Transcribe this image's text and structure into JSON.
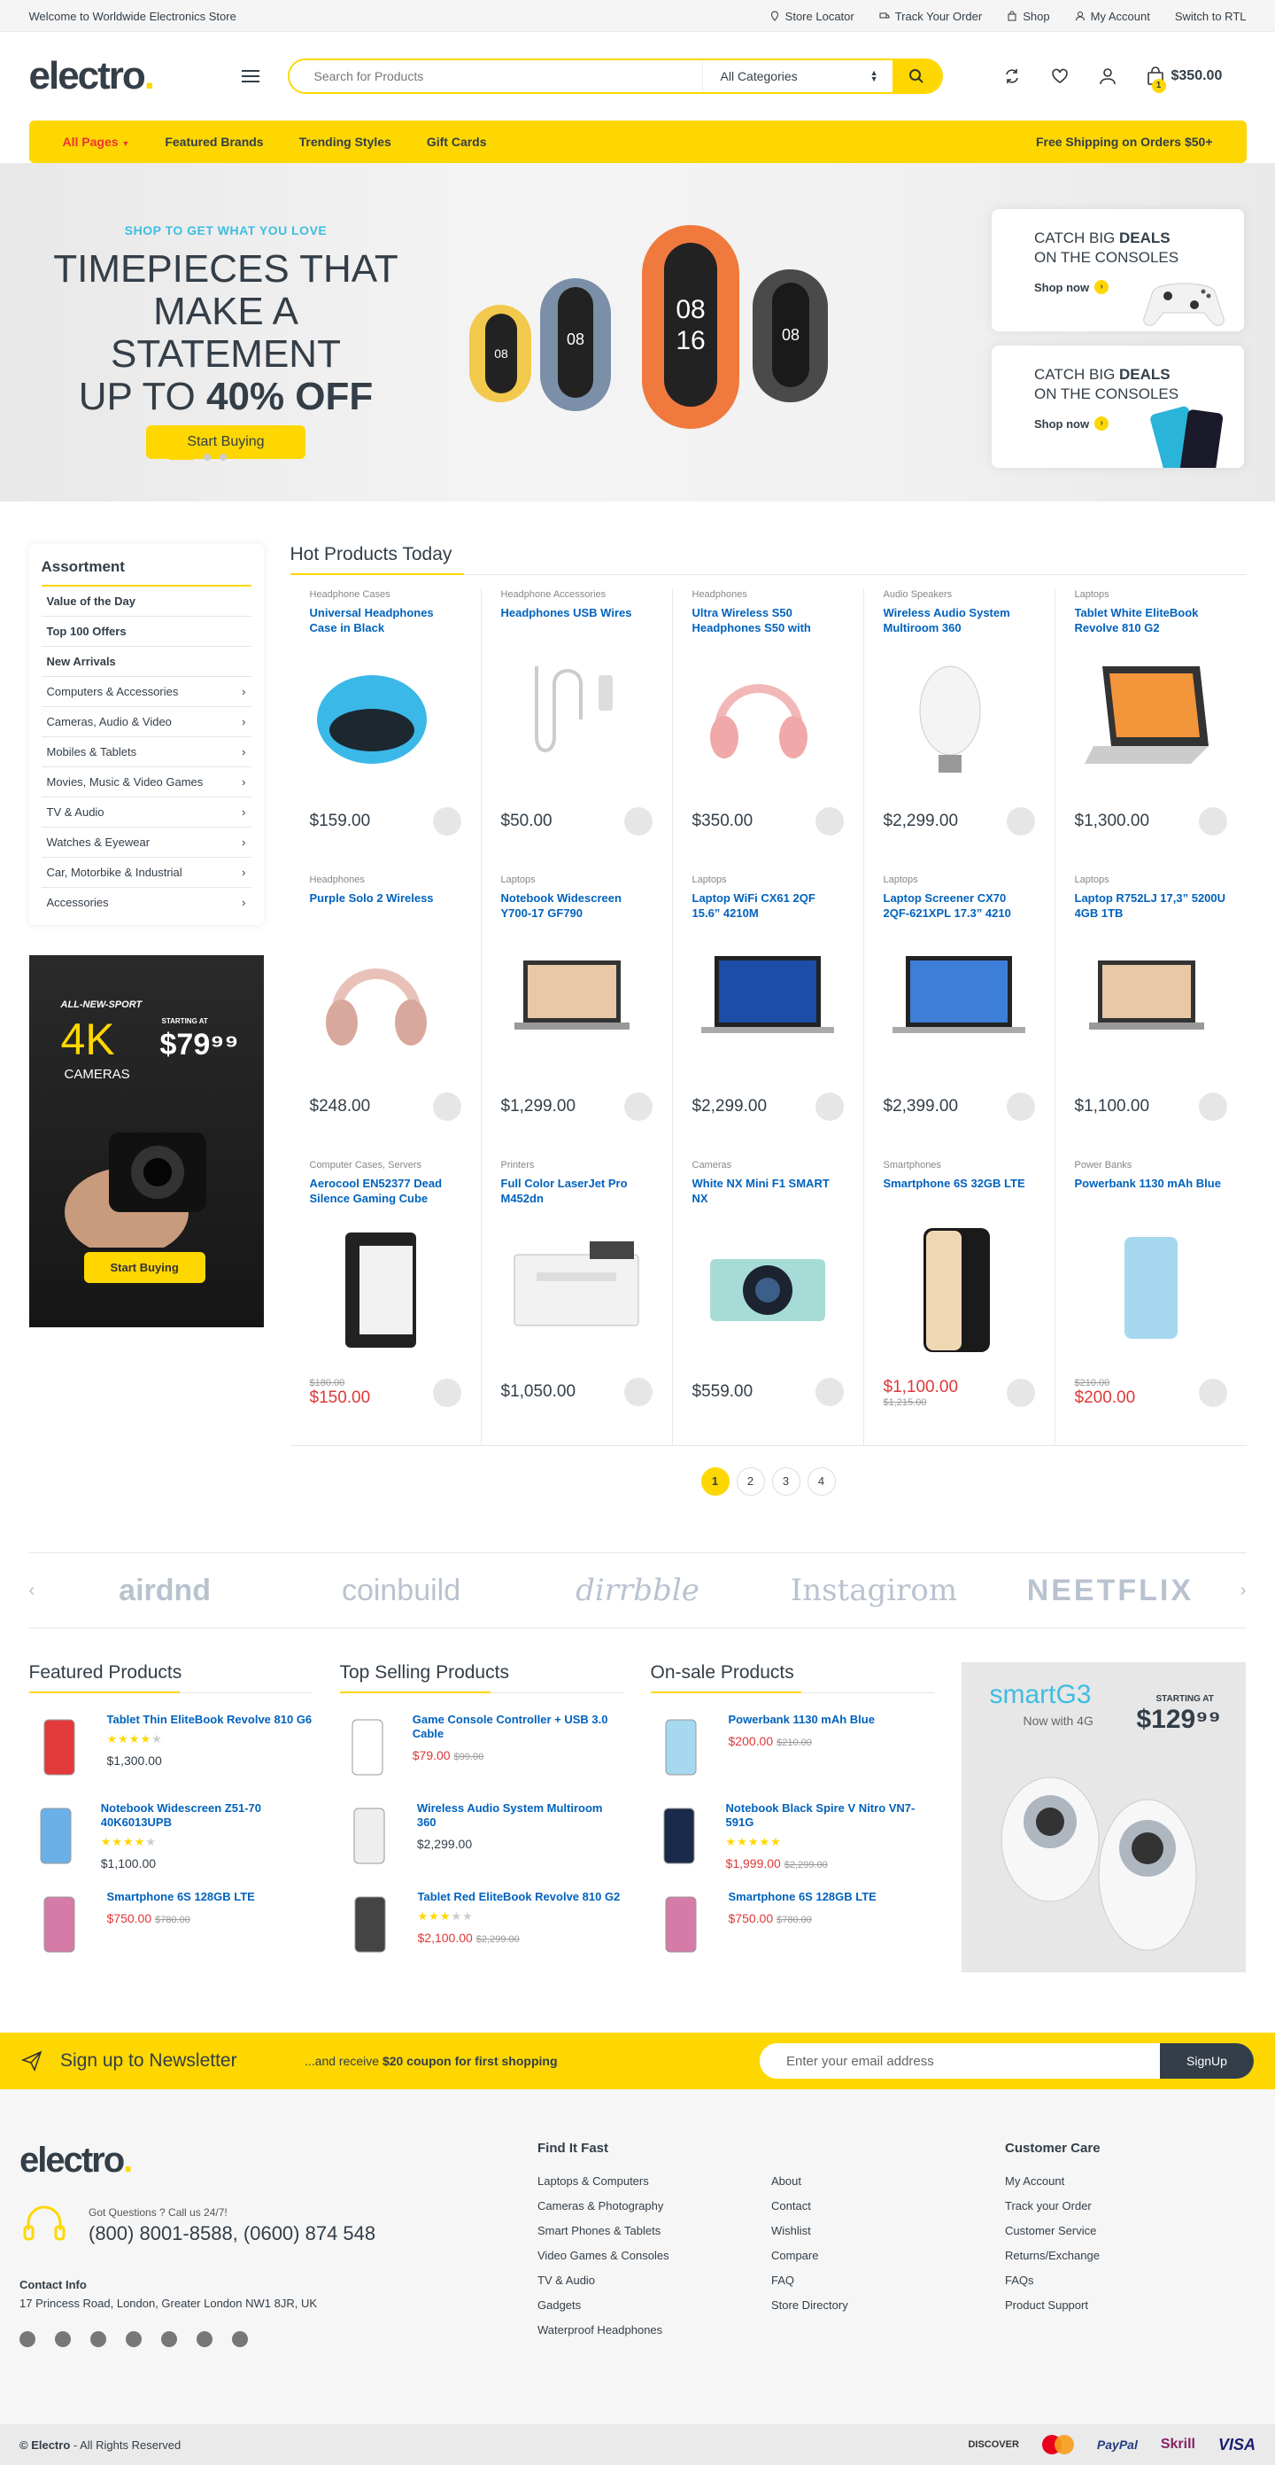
{
  "topbar": {
    "welcome": "Welcome to Worldwide Electronics Store",
    "links": [
      "Store Locator",
      "Track Your Order",
      "Shop",
      "My Account",
      "Switch to RTL"
    ]
  },
  "header": {
    "logo": "electro",
    "search_placeholder": "Search for Products",
    "category": "All Categories",
    "cart_total": "$350.00",
    "cart_count": "1"
  },
  "nav": {
    "items": [
      "All Pages",
      "Featured Brands",
      "Trending Styles",
      "Gift Cards"
    ],
    "shipping": "Free Shipping on Orders $50+"
  },
  "hero": {
    "subtitle": "SHOP TO GET WHAT YOU LOVE",
    "title_line1": "TIMEPIECES THAT",
    "title_line2": "MAKE A STATEMENT",
    "title_line3_a": "UP TO ",
    "title_line3_b": "40% OFF",
    "button": "Start Buying",
    "promo1": {
      "title_a": "CATCH BIG ",
      "title_b": "DEALS",
      "title_c": " ON THE CONSOLES",
      "cta": "Shop now"
    },
    "promo2": {
      "title_a": "CATCH BIG ",
      "title_b": "DEALS",
      "title_c": " ON THE CONSOLES",
      "cta": "Shop now"
    }
  },
  "sidebar": {
    "title": "Assortment",
    "bold_items": [
      "Value of the Day",
      "Top 100 Offers",
      "New Arrivals"
    ],
    "items": [
      "Computers & Accessories",
      "Cameras, Audio & Video",
      "Mobiles & Tablets",
      "Movies, Music & Video Games",
      "TV & Audio",
      "Watches & Eyewear",
      "Car, Motorbike & Industrial",
      "Accessories"
    ],
    "ad": {
      "line1": "ALL-NEW-SPORT",
      "big": "4K",
      "line2": "CAMERAS",
      "starting": "STARTING AT",
      "price": "$79⁹⁹",
      "button": "Start Buying"
    }
  },
  "hot": {
    "title": "Hot Products Today",
    "products": [
      {
        "cat": "Headphone Cases",
        "name": "Universal Headphones Case in Black",
        "price": "$159.00",
        "old": "",
        "sale": false
      },
      {
        "cat": "Headphone Accessories",
        "name": "Headphones USB Wires",
        "price": "$50.00",
        "old": "",
        "sale": false
      },
      {
        "cat": "Headphones",
        "name": "Ultra Wireless S50 Headphones S50 with",
        "price": "$350.00",
        "old": "",
        "sale": false
      },
      {
        "cat": "Audio Speakers",
        "name": "Wireless Audio System Multiroom 360",
        "price": "$2,299.00",
        "old": "",
        "sale": false
      },
      {
        "cat": "Laptops",
        "name": "Tablet White EliteBook Revolve 810 G2",
        "price": "$1,300.00",
        "old": "",
        "sale": false
      },
      {
        "cat": "Headphones",
        "name": "Purple Solo 2 Wireless",
        "price": "$248.00",
        "old": "",
        "sale": false
      },
      {
        "cat": "Laptops",
        "name": "Notebook Widescreen Y700-17 GF790",
        "price": "$1,299.00",
        "old": "",
        "sale": false
      },
      {
        "cat": "Laptops",
        "name": "Laptop WiFi CX61 2QF 15.6” 4210M",
        "price": "$2,299.00",
        "old": "",
        "sale": false
      },
      {
        "cat": "Laptops",
        "name": "Laptop Screener CX70 2QF-621XPL 17.3” 4210",
        "price": "$2,399.00",
        "old": "",
        "sale": false
      },
      {
        "cat": "Laptops",
        "name": "Laptop R752LJ 17,3” 5200U 4GB 1TB",
        "price": "$1,100.00",
        "old": "",
        "sale": false
      },
      {
        "cat": "Computer Cases, Servers",
        "name": "Aerocool EN52377 Dead Silence Gaming Cube",
        "price": "$150.00",
        "old": "$180.00",
        "sale": true
      },
      {
        "cat": "Printers",
        "name": "Full Color LaserJet Pro M452dn",
        "price": "$1,050.00",
        "old": "",
        "sale": false
      },
      {
        "cat": "Cameras",
        "name": "White NX Mini F1 SMART NX",
        "price": "$559.00",
        "old": "",
        "sale": false
      },
      {
        "cat": "Smartphones",
        "name": "Smartphone 6S 32GB LTE",
        "price": "$1,100.00",
        "old": "$1,215.00",
        "sale": true
      },
      {
        "cat": "Power Banks",
        "name": "Powerbank 1130 mAh Blue",
        "price": "$200.00",
        "old": "$210.00",
        "sale": true
      }
    ],
    "pages": [
      "1",
      "2",
      "3",
      "4"
    ]
  },
  "brands": [
    "airdnd",
    "coinbuild",
    "dirrbble",
    "Instagirom",
    "NEETFLIX"
  ],
  "lists": [
    {
      "title": "Featured Products",
      "items": [
        {
          "name": "Tablet Thin EliteBook Revolve 810 G6",
          "stars": 4,
          "price": "$1,300.00",
          "old": "",
          "sale": false
        },
        {
          "name": "Notebook Widescreen Z51-70 40K6013UPB",
          "stars": 4,
          "price": "$1,100.00",
          "old": "",
          "sale": false
        },
        {
          "name": "Smartphone 6S 128GB LTE",
          "stars": 0,
          "price": "$750.00",
          "old": "$780.00",
          "sale": true
        }
      ]
    },
    {
      "title": "Top Selling Products",
      "items": [
        {
          "name": "Game Console Controller + USB 3.0 Cable",
          "stars": 0,
          "price": "$79.00",
          "old": "$99.00",
          "sale": true
        },
        {
          "name": "Wireless Audio System Multiroom 360",
          "stars": 0,
          "price": "$2,299.00",
          "old": "",
          "sale": false
        },
        {
          "name": "Tablet Red EliteBook Revolve 810 G2",
          "stars": 3,
          "price": "$2,100.00",
          "old": "$2,299.00",
          "sale": true
        }
      ]
    },
    {
      "title": "On-sale Products",
      "items": [
        {
          "name": "Powerbank 1130 mAh Blue",
          "stars": 0,
          "price": "$200.00",
          "old": "$210.00",
          "sale": true
        },
        {
          "name": "Notebook Black Spire V Nitro VN7-591G",
          "stars": 5,
          "price": "$1,999.00",
          "old": "$2,299.00",
          "sale": true
        },
        {
          "name": "Smartphone 6S 128GB LTE",
          "stars": 0,
          "price": "$750.00",
          "old": "$780.00",
          "sale": true
        }
      ]
    }
  ],
  "ad_g3": {
    "name_a": "smart",
    "name_b": "G3",
    "sub": "Now with 4G",
    "starting": "STARTING AT",
    "price": "$129⁹⁹"
  },
  "newsletter": {
    "title": "Sign up to Newsletter",
    "text_a": "...and receive ",
    "text_b": "$20 coupon for first shopping",
    "placeholder": "Enter your email address",
    "button": "SignUp"
  },
  "footer": {
    "logo": "electro",
    "question": "Got Questions ? Call us 24/7!",
    "phone": "(800) 8001-8588, (0600) 874 548",
    "contact_title": "Contact Info",
    "address": "17 Princess Road, London, Greater London NW1 8JR, UK",
    "find_title": "Find It Fast",
    "find_col1": [
      "Laptops & Computers",
      "Cameras & Photography",
      "Smart Phones & Tablets",
      "Video Games & Consoles",
      "TV & Audio",
      "Gadgets",
      "Waterproof Headphones"
    ],
    "find_col2": [
      "About",
      "Contact",
      "Wishlist",
      "Compare",
      "FAQ",
      "Store Directory"
    ],
    "care_title": "Customer Care",
    "care": [
      "My Account",
      "Track your Order",
      "Customer Service",
      "Returns/Exchange",
      "FAQs",
      "Product Support"
    ],
    "copyright_a": "© Electro",
    "copyright_b": " - All Rights Reserved",
    "payments": [
      "DISCOVER",
      "mastercard",
      "PayPal",
      "Skrill",
      "VISA"
    ]
  },
  "colors": {
    "accent": "#fed700",
    "link": "#0062bd",
    "sale": "#df3737",
    "text": "#333e48"
  }
}
